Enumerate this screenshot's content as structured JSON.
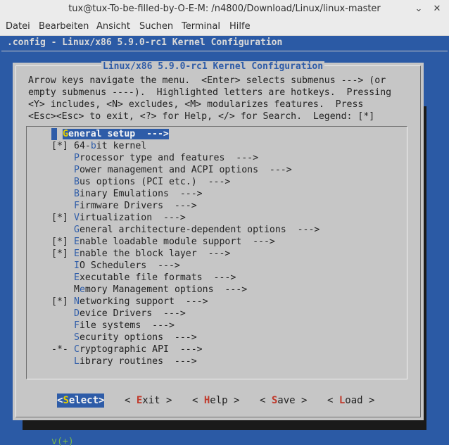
{
  "window": {
    "title": "tux@tux-To-be-filled-by-O-E-M: /n4800/Download/Linux/linux-master"
  },
  "menubar": [
    "Datei",
    "Bearbeiten",
    "Ansicht",
    "Suchen",
    "Terminal",
    "Hilfe"
  ],
  "terminal": {
    "headline": ".config - Linux/x86 5.9.0-rc1 Kernel Configuration",
    "dialog_title": "Linux/x86 5.9.0-rc1 Kernel Configuration",
    "help_text": "Arrow keys navigate the menu.  <Enter> selects submenus ---> (or\nempty submenus ----).  Highlighted letters are hotkeys.  Pressing\n<Y> includes, <N> excludes, <M> modularizes features.  Press\n<Esc><Esc> to exit, <?> for Help, </> for Search.  Legend: [*]",
    "items": [
      {
        "prefix": "",
        "hotkey": "G",
        "rest": "eneral setup  --->",
        "selected": true
      },
      {
        "prefix": "[*]",
        "hotkey": "",
        "rest": "64-",
        "hotkey2": "b",
        "rest2": "it kernel"
      },
      {
        "prefix": "",
        "hotkey": "P",
        "rest": "rocessor type and features  --->"
      },
      {
        "prefix": "",
        "hotkey": "P",
        "rest": "ower management and ACPI options  --->"
      },
      {
        "prefix": "",
        "hotkey": "B",
        "rest": "us options (PCI etc.)  --->"
      },
      {
        "prefix": "",
        "hotkey": "B",
        "rest": "inary Emulations  --->"
      },
      {
        "prefix": "",
        "hotkey": "F",
        "rest": "irmware Drivers  --->"
      },
      {
        "prefix": "[*]",
        "hotkey": "V",
        "rest": "irtualization  --->"
      },
      {
        "prefix": "",
        "hotkey": "G",
        "rest": "eneral architecture-dependent options  --->"
      },
      {
        "prefix": "[*]",
        "hotkey": "E",
        "rest": "nable loadable module support  --->"
      },
      {
        "prefix": "[*]",
        "hotkey": "E",
        "rest": "nable the block layer  --->"
      },
      {
        "prefix": "",
        "hotkey": "I",
        "rest": "O Schedulers  --->"
      },
      {
        "prefix": "",
        "hotkey": "E",
        "rest": "xecutable file formats  --->"
      },
      {
        "prefix": "",
        "hotkey": "",
        "rest": "M",
        "hotkey2": "e",
        "rest2": "mory Management options  --->"
      },
      {
        "prefix": "[*]",
        "hotkey": "N",
        "rest": "etworking support  --->"
      },
      {
        "prefix": "",
        "hotkey": "D",
        "rest": "evice Drivers  --->"
      },
      {
        "prefix": "",
        "hotkey": "F",
        "rest": "ile systems  --->"
      },
      {
        "prefix": "",
        "hotkey": "S",
        "rest": "ecurity options  --->"
      },
      {
        "prefix": "-*-",
        "hotkey": "C",
        "rest": "ryptographic API  --->"
      },
      {
        "prefix": "",
        "hotkey": "L",
        "rest": "ibrary routines  --->"
      }
    ],
    "more_indicator": "v(+)",
    "buttons": [
      {
        "pre": "<",
        "hotkey": "S",
        "post": "elect>",
        "active": true
      },
      {
        "pre": "< ",
        "hotkey": "E",
        "post": "xit >"
      },
      {
        "pre": "< ",
        "hotkey": "H",
        "post": "elp >"
      },
      {
        "pre": "< ",
        "hotkey": "S",
        "post": "ave >"
      },
      {
        "pre": "< ",
        "hotkey": "L",
        "post": "oad >"
      }
    ]
  }
}
